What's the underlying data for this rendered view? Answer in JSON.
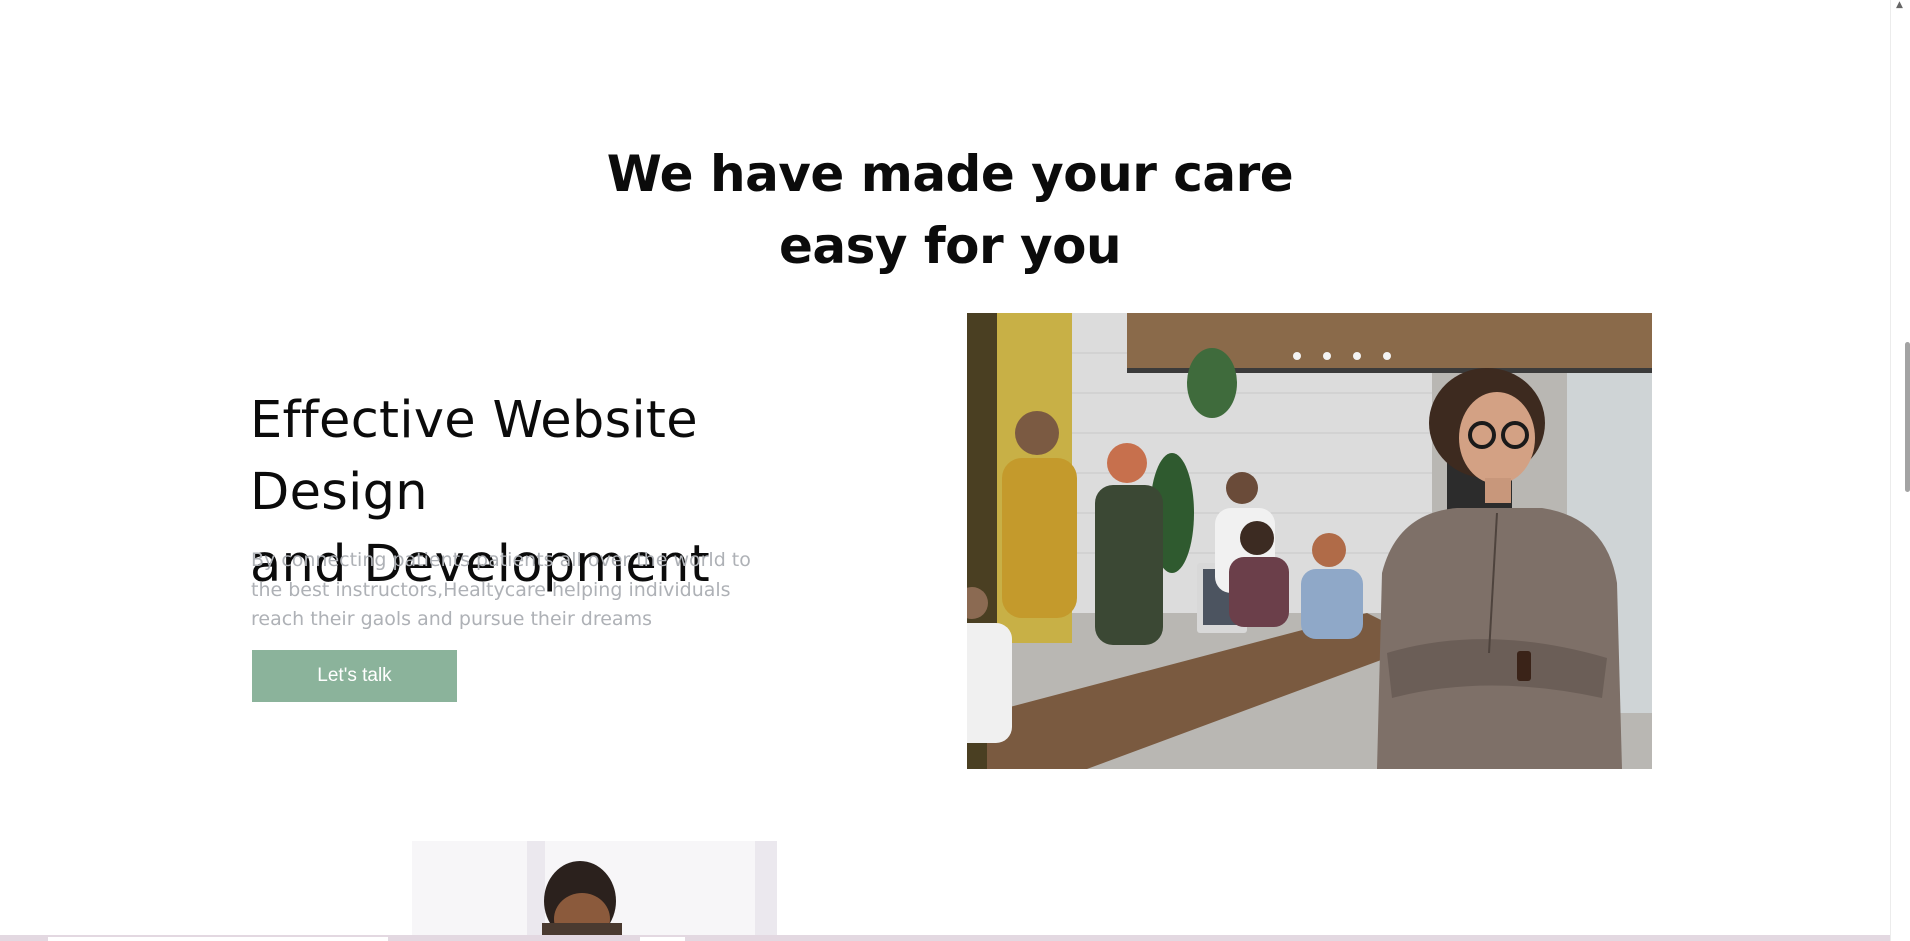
{
  "section": {
    "headline_line1": "We have made your care",
    "headline_line2": "easy for you"
  },
  "feature": {
    "title_line1": "Effective Website Design",
    "title_line2": "and Development",
    "desc_line1": "By connecting patients patients all over the world to",
    "desc_line2": "the best instructors,Healtycare helping individuals",
    "desc_line3": "reach their gaols and pursue their dreams",
    "cta_label": "Let's talk"
  },
  "colors": {
    "cta_background": "#8bb39b",
    "description_text": "#aeb1b6",
    "heading_text": "#0b0b0b"
  }
}
